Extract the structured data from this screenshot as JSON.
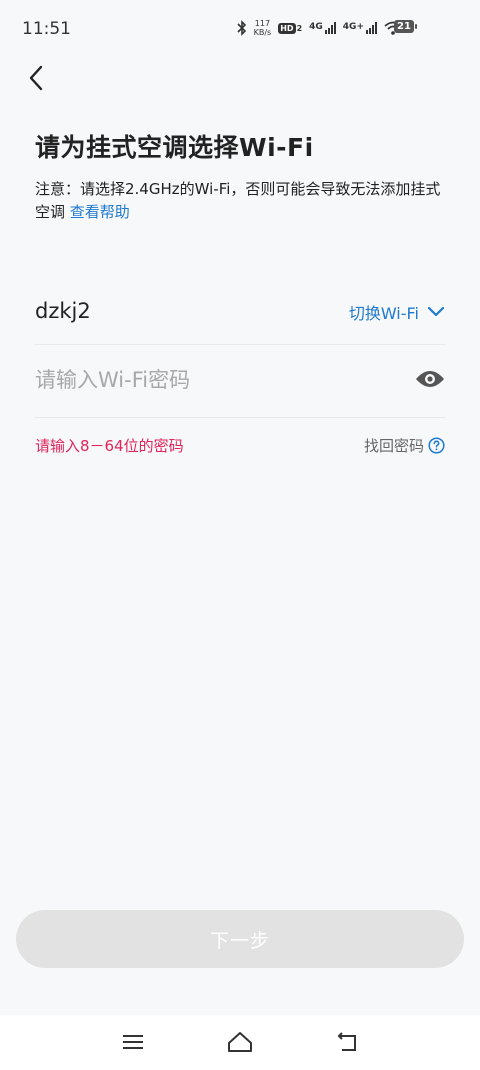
{
  "status_bar": {
    "time": "11:51",
    "net_speed_value": "117",
    "net_speed_unit": "KB/s",
    "hd_label": "HD",
    "hd_sub": "2",
    "signal1_label": "4G",
    "signal2_label": "4G+",
    "battery_level": "21"
  },
  "header": {
    "back_icon": "chevron-left-icon",
    "title": "请为挂式空调选择Wi-Fi"
  },
  "notice": {
    "text": "注意：请选择2.4GHz的Wi-Fi，否则可能会导致无法添加挂式空调",
    "help_link": "查看帮助"
  },
  "wifi": {
    "ssid": "dzkj2",
    "switch_label": "切换Wi-Fi"
  },
  "password": {
    "value": "",
    "placeholder": "请输入Wi-Fi密码",
    "hint": "请输入8－64位的密码",
    "forgot_label": "找回密码"
  },
  "footer": {
    "next_label": "下一步"
  },
  "colors": {
    "accent": "#1f7ad1",
    "error": "#e1255b",
    "button_disabled": "#e2e2e2"
  }
}
